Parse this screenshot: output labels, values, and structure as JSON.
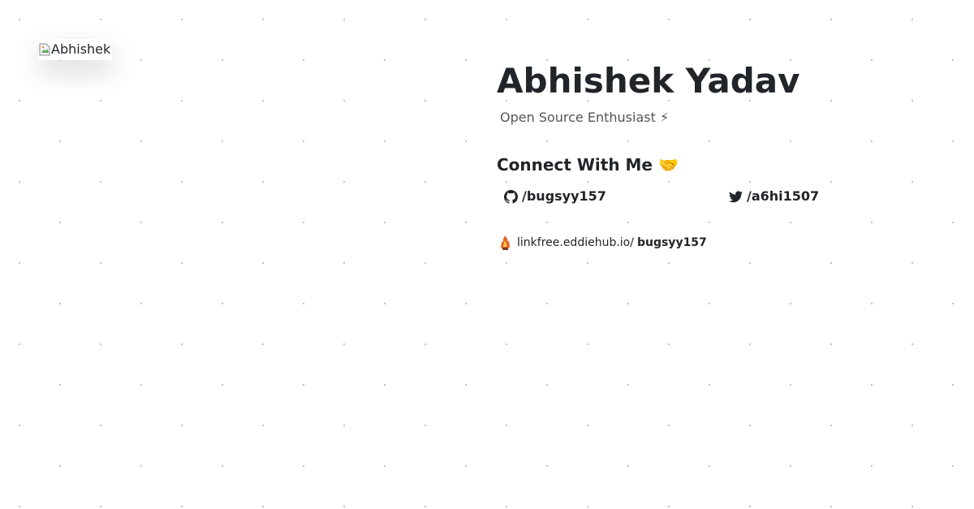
{
  "profile": {
    "avatar_alt": "Abhishek",
    "name": "Abhishek Yadav",
    "tagline": "Open Source Enthusiast ⚡"
  },
  "connect": {
    "heading": "Connect With Me 🤝",
    "github": {
      "icon": "github-icon",
      "handle": "/bugsyy157"
    },
    "twitter": {
      "icon": "twitter-icon",
      "handle": "/a6hi1507"
    }
  },
  "linkfree": {
    "icon": "linkfree-logo-icon",
    "prefix": "linkfree.eddiehub.io/",
    "username": "bugsyy157"
  }
}
